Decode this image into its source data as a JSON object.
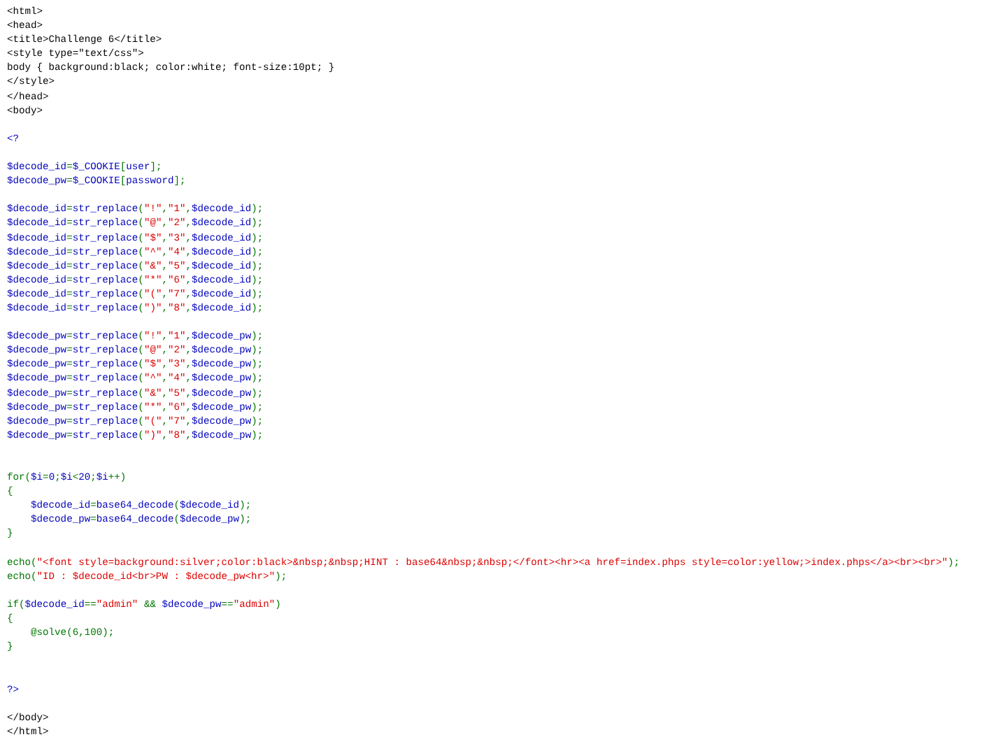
{
  "source_lines": [
    {
      "kind": "code",
      "tokens": [
        {
          "kind": "html",
          "text": "<html>"
        }
      ]
    },
    {
      "kind": "code",
      "tokens": [
        {
          "kind": "html",
          "text": "<head>"
        }
      ]
    },
    {
      "kind": "code",
      "tokens": [
        {
          "kind": "html",
          "text": "<title>Challenge 6</title>"
        }
      ]
    },
    {
      "kind": "code",
      "tokens": [
        {
          "kind": "html",
          "text": "<style type=\"text/css\">"
        }
      ]
    },
    {
      "kind": "code",
      "tokens": [
        {
          "kind": "html",
          "text": "body { background:black; color:white; font-size:10pt; }"
        }
      ]
    },
    {
      "kind": "code",
      "tokens": [
        {
          "kind": "html",
          "text": "</style>"
        }
      ]
    },
    {
      "kind": "code",
      "tokens": [
        {
          "kind": "html",
          "text": "</head>"
        }
      ]
    },
    {
      "kind": "code",
      "tokens": [
        {
          "kind": "html",
          "text": "<body>"
        }
      ]
    },
    {
      "kind": "blank"
    },
    {
      "kind": "code",
      "tokens": [
        {
          "kind": "default",
          "text": "<?"
        }
      ]
    },
    {
      "kind": "blank"
    },
    {
      "kind": "code",
      "tokens": [
        {
          "kind": "default",
          "text": "$decode_id"
        },
        {
          "kind": "keyword",
          "text": "="
        },
        {
          "kind": "default",
          "text": "$_COOKIE"
        },
        {
          "kind": "keyword",
          "text": "["
        },
        {
          "kind": "default",
          "text": "user"
        },
        {
          "kind": "keyword",
          "text": "];"
        }
      ]
    },
    {
      "kind": "code",
      "tokens": [
        {
          "kind": "default",
          "text": "$decode_pw"
        },
        {
          "kind": "keyword",
          "text": "="
        },
        {
          "kind": "default",
          "text": "$_COOKIE"
        },
        {
          "kind": "keyword",
          "text": "["
        },
        {
          "kind": "default",
          "text": "password"
        },
        {
          "kind": "keyword",
          "text": "];"
        }
      ]
    },
    {
      "kind": "blank"
    },
    {
      "kind": "code",
      "tokens": [
        {
          "kind": "default",
          "text": "$decode_id"
        },
        {
          "kind": "keyword",
          "text": "="
        },
        {
          "kind": "default",
          "text": "str_replace"
        },
        {
          "kind": "keyword",
          "text": "("
        },
        {
          "kind": "string",
          "text": "\"!\""
        },
        {
          "kind": "keyword",
          "text": ","
        },
        {
          "kind": "string",
          "text": "\"1\""
        },
        {
          "kind": "keyword",
          "text": ","
        },
        {
          "kind": "default",
          "text": "$decode_id"
        },
        {
          "kind": "keyword",
          "text": ");"
        }
      ]
    },
    {
      "kind": "code",
      "tokens": [
        {
          "kind": "default",
          "text": "$decode_id"
        },
        {
          "kind": "keyword",
          "text": "="
        },
        {
          "kind": "default",
          "text": "str_replace"
        },
        {
          "kind": "keyword",
          "text": "("
        },
        {
          "kind": "string",
          "text": "\"@\""
        },
        {
          "kind": "keyword",
          "text": ","
        },
        {
          "kind": "string",
          "text": "\"2\""
        },
        {
          "kind": "keyword",
          "text": ","
        },
        {
          "kind": "default",
          "text": "$decode_id"
        },
        {
          "kind": "keyword",
          "text": ");"
        }
      ]
    },
    {
      "kind": "code",
      "tokens": [
        {
          "kind": "default",
          "text": "$decode_id"
        },
        {
          "kind": "keyword",
          "text": "="
        },
        {
          "kind": "default",
          "text": "str_replace"
        },
        {
          "kind": "keyword",
          "text": "("
        },
        {
          "kind": "string",
          "text": "\"$\""
        },
        {
          "kind": "keyword",
          "text": ","
        },
        {
          "kind": "string",
          "text": "\"3\""
        },
        {
          "kind": "keyword",
          "text": ","
        },
        {
          "kind": "default",
          "text": "$decode_id"
        },
        {
          "kind": "keyword",
          "text": ");"
        }
      ]
    },
    {
      "kind": "code",
      "tokens": [
        {
          "kind": "default",
          "text": "$decode_id"
        },
        {
          "kind": "keyword",
          "text": "="
        },
        {
          "kind": "default",
          "text": "str_replace"
        },
        {
          "kind": "keyword",
          "text": "("
        },
        {
          "kind": "string",
          "text": "\"^\""
        },
        {
          "kind": "keyword",
          "text": ","
        },
        {
          "kind": "string",
          "text": "\"4\""
        },
        {
          "kind": "keyword",
          "text": ","
        },
        {
          "kind": "default",
          "text": "$decode_id"
        },
        {
          "kind": "keyword",
          "text": ");"
        }
      ]
    },
    {
      "kind": "code",
      "tokens": [
        {
          "kind": "default",
          "text": "$decode_id"
        },
        {
          "kind": "keyword",
          "text": "="
        },
        {
          "kind": "default",
          "text": "str_replace"
        },
        {
          "kind": "keyword",
          "text": "("
        },
        {
          "kind": "string",
          "text": "\"&\""
        },
        {
          "kind": "keyword",
          "text": ","
        },
        {
          "kind": "string",
          "text": "\"5\""
        },
        {
          "kind": "keyword",
          "text": ","
        },
        {
          "kind": "default",
          "text": "$decode_id"
        },
        {
          "kind": "keyword",
          "text": ");"
        }
      ]
    },
    {
      "kind": "code",
      "tokens": [
        {
          "kind": "default",
          "text": "$decode_id"
        },
        {
          "kind": "keyword",
          "text": "="
        },
        {
          "kind": "default",
          "text": "str_replace"
        },
        {
          "kind": "keyword",
          "text": "("
        },
        {
          "kind": "string",
          "text": "\"*\""
        },
        {
          "kind": "keyword",
          "text": ","
        },
        {
          "kind": "string",
          "text": "\"6\""
        },
        {
          "kind": "keyword",
          "text": ","
        },
        {
          "kind": "default",
          "text": "$decode_id"
        },
        {
          "kind": "keyword",
          "text": ");"
        }
      ]
    },
    {
      "kind": "code",
      "tokens": [
        {
          "kind": "default",
          "text": "$decode_id"
        },
        {
          "kind": "keyword",
          "text": "="
        },
        {
          "kind": "default",
          "text": "str_replace"
        },
        {
          "kind": "keyword",
          "text": "("
        },
        {
          "kind": "string",
          "text": "\"(\""
        },
        {
          "kind": "keyword",
          "text": ","
        },
        {
          "kind": "string",
          "text": "\"7\""
        },
        {
          "kind": "keyword",
          "text": ","
        },
        {
          "kind": "default",
          "text": "$decode_id"
        },
        {
          "kind": "keyword",
          "text": ");"
        }
      ]
    },
    {
      "kind": "code",
      "tokens": [
        {
          "kind": "default",
          "text": "$decode_id"
        },
        {
          "kind": "keyword",
          "text": "="
        },
        {
          "kind": "default",
          "text": "str_replace"
        },
        {
          "kind": "keyword",
          "text": "("
        },
        {
          "kind": "string",
          "text": "\")\""
        },
        {
          "kind": "keyword",
          "text": ","
        },
        {
          "kind": "string",
          "text": "\"8\""
        },
        {
          "kind": "keyword",
          "text": ","
        },
        {
          "kind": "default",
          "text": "$decode_id"
        },
        {
          "kind": "keyword",
          "text": ");"
        }
      ]
    },
    {
      "kind": "blank"
    },
    {
      "kind": "code",
      "tokens": [
        {
          "kind": "default",
          "text": "$decode_pw"
        },
        {
          "kind": "keyword",
          "text": "="
        },
        {
          "kind": "default",
          "text": "str_replace"
        },
        {
          "kind": "keyword",
          "text": "("
        },
        {
          "kind": "string",
          "text": "\"!\""
        },
        {
          "kind": "keyword",
          "text": ","
        },
        {
          "kind": "string",
          "text": "\"1\""
        },
        {
          "kind": "keyword",
          "text": ","
        },
        {
          "kind": "default",
          "text": "$decode_pw"
        },
        {
          "kind": "keyword",
          "text": ");"
        }
      ]
    },
    {
      "kind": "code",
      "tokens": [
        {
          "kind": "default",
          "text": "$decode_pw"
        },
        {
          "kind": "keyword",
          "text": "="
        },
        {
          "kind": "default",
          "text": "str_replace"
        },
        {
          "kind": "keyword",
          "text": "("
        },
        {
          "kind": "string",
          "text": "\"@\""
        },
        {
          "kind": "keyword",
          "text": ","
        },
        {
          "kind": "string",
          "text": "\"2\""
        },
        {
          "kind": "keyword",
          "text": ","
        },
        {
          "kind": "default",
          "text": "$decode_pw"
        },
        {
          "kind": "keyword",
          "text": ");"
        }
      ]
    },
    {
      "kind": "code",
      "tokens": [
        {
          "kind": "default",
          "text": "$decode_pw"
        },
        {
          "kind": "keyword",
          "text": "="
        },
        {
          "kind": "default",
          "text": "str_replace"
        },
        {
          "kind": "keyword",
          "text": "("
        },
        {
          "kind": "string",
          "text": "\"$\""
        },
        {
          "kind": "keyword",
          "text": ","
        },
        {
          "kind": "string",
          "text": "\"3\""
        },
        {
          "kind": "keyword",
          "text": ","
        },
        {
          "kind": "default",
          "text": "$decode_pw"
        },
        {
          "kind": "keyword",
          "text": ");"
        }
      ]
    },
    {
      "kind": "code",
      "tokens": [
        {
          "kind": "default",
          "text": "$decode_pw"
        },
        {
          "kind": "keyword",
          "text": "="
        },
        {
          "kind": "default",
          "text": "str_replace"
        },
        {
          "kind": "keyword",
          "text": "("
        },
        {
          "kind": "string",
          "text": "\"^\""
        },
        {
          "kind": "keyword",
          "text": ","
        },
        {
          "kind": "string",
          "text": "\"4\""
        },
        {
          "kind": "keyword",
          "text": ","
        },
        {
          "kind": "default",
          "text": "$decode_pw"
        },
        {
          "kind": "keyword",
          "text": ");"
        }
      ]
    },
    {
      "kind": "code",
      "tokens": [
        {
          "kind": "default",
          "text": "$decode_pw"
        },
        {
          "kind": "keyword",
          "text": "="
        },
        {
          "kind": "default",
          "text": "str_replace"
        },
        {
          "kind": "keyword",
          "text": "("
        },
        {
          "kind": "string",
          "text": "\"&\""
        },
        {
          "kind": "keyword",
          "text": ","
        },
        {
          "kind": "string",
          "text": "\"5\""
        },
        {
          "kind": "keyword",
          "text": ","
        },
        {
          "kind": "default",
          "text": "$decode_pw"
        },
        {
          "kind": "keyword",
          "text": ");"
        }
      ]
    },
    {
      "kind": "code",
      "tokens": [
        {
          "kind": "default",
          "text": "$decode_pw"
        },
        {
          "kind": "keyword",
          "text": "="
        },
        {
          "kind": "default",
          "text": "str_replace"
        },
        {
          "kind": "keyword",
          "text": "("
        },
        {
          "kind": "string",
          "text": "\"*\""
        },
        {
          "kind": "keyword",
          "text": ","
        },
        {
          "kind": "string",
          "text": "\"6\""
        },
        {
          "kind": "keyword",
          "text": ","
        },
        {
          "kind": "default",
          "text": "$decode_pw"
        },
        {
          "kind": "keyword",
          "text": ");"
        }
      ]
    },
    {
      "kind": "code",
      "tokens": [
        {
          "kind": "default",
          "text": "$decode_pw"
        },
        {
          "kind": "keyword",
          "text": "="
        },
        {
          "kind": "default",
          "text": "str_replace"
        },
        {
          "kind": "keyword",
          "text": "("
        },
        {
          "kind": "string",
          "text": "\"(\""
        },
        {
          "kind": "keyword",
          "text": ","
        },
        {
          "kind": "string",
          "text": "\"7\""
        },
        {
          "kind": "keyword",
          "text": ","
        },
        {
          "kind": "default",
          "text": "$decode_pw"
        },
        {
          "kind": "keyword",
          "text": ");"
        }
      ]
    },
    {
      "kind": "code",
      "tokens": [
        {
          "kind": "default",
          "text": "$decode_pw"
        },
        {
          "kind": "keyword",
          "text": "="
        },
        {
          "kind": "default",
          "text": "str_replace"
        },
        {
          "kind": "keyword",
          "text": "("
        },
        {
          "kind": "string",
          "text": "\")\""
        },
        {
          "kind": "keyword",
          "text": ","
        },
        {
          "kind": "string",
          "text": "\"8\""
        },
        {
          "kind": "keyword",
          "text": ","
        },
        {
          "kind": "default",
          "text": "$decode_pw"
        },
        {
          "kind": "keyword",
          "text": ");"
        }
      ]
    },
    {
      "kind": "blank"
    },
    {
      "kind": "blank"
    },
    {
      "kind": "code",
      "tokens": [
        {
          "kind": "keyword",
          "text": "for("
        },
        {
          "kind": "default",
          "text": "$i"
        },
        {
          "kind": "keyword",
          "text": "="
        },
        {
          "kind": "default",
          "text": "0"
        },
        {
          "kind": "keyword",
          "text": ";"
        },
        {
          "kind": "default",
          "text": "$i"
        },
        {
          "kind": "keyword",
          "text": "<"
        },
        {
          "kind": "default",
          "text": "20"
        },
        {
          "kind": "keyword",
          "text": ";"
        },
        {
          "kind": "default",
          "text": "$i"
        },
        {
          "kind": "keyword",
          "text": "++)"
        }
      ]
    },
    {
      "kind": "code",
      "tokens": [
        {
          "kind": "keyword",
          "text": "{"
        }
      ]
    },
    {
      "kind": "code",
      "tokens": [
        {
          "kind": "default",
          "text": "    $decode_id"
        },
        {
          "kind": "keyword",
          "text": "="
        },
        {
          "kind": "default",
          "text": "base64_decode"
        },
        {
          "kind": "keyword",
          "text": "("
        },
        {
          "kind": "default",
          "text": "$decode_id"
        },
        {
          "kind": "keyword",
          "text": ");"
        }
      ]
    },
    {
      "kind": "code",
      "tokens": [
        {
          "kind": "default",
          "text": "    $decode_pw"
        },
        {
          "kind": "keyword",
          "text": "="
        },
        {
          "kind": "default",
          "text": "base64_decode"
        },
        {
          "kind": "keyword",
          "text": "("
        },
        {
          "kind": "default",
          "text": "$decode_pw"
        },
        {
          "kind": "keyword",
          "text": ");"
        }
      ]
    },
    {
      "kind": "code",
      "tokens": [
        {
          "kind": "keyword",
          "text": "}"
        }
      ]
    },
    {
      "kind": "blank"
    },
    {
      "kind": "code",
      "tokens": [
        {
          "kind": "keyword",
          "text": "echo("
        },
        {
          "kind": "string",
          "text": "\"<font style=background:silver;color:black>&nbsp;&nbsp;HINT : base64&nbsp;&nbsp;</font><hr><a href=index.phps style=color:yellow;>index.phps</a><br><br>\""
        },
        {
          "kind": "keyword",
          "text": ");"
        }
      ]
    },
    {
      "kind": "code",
      "tokens": [
        {
          "kind": "keyword",
          "text": "echo("
        },
        {
          "kind": "string",
          "text": "\"ID : $decode_id<br>PW : $decode_pw<hr>\""
        },
        {
          "kind": "keyword",
          "text": ");"
        }
      ]
    },
    {
      "kind": "blank"
    },
    {
      "kind": "code",
      "tokens": [
        {
          "kind": "keyword",
          "text": "if("
        },
        {
          "kind": "default",
          "text": "$decode_id"
        },
        {
          "kind": "keyword",
          "text": "=="
        },
        {
          "kind": "string",
          "text": "\"admin\""
        },
        {
          "kind": "keyword",
          "text": " && "
        },
        {
          "kind": "default",
          "text": "$decode_pw"
        },
        {
          "kind": "keyword",
          "text": "=="
        },
        {
          "kind": "string",
          "text": "\"admin\""
        },
        {
          "kind": "keyword",
          "text": ")"
        }
      ]
    },
    {
      "kind": "code",
      "tokens": [
        {
          "kind": "keyword",
          "text": "{"
        }
      ]
    },
    {
      "kind": "code",
      "tokens": [
        {
          "kind": "keyword",
          "text": "    @solve(6,100);"
        }
      ]
    },
    {
      "kind": "code",
      "tokens": [
        {
          "kind": "keyword",
          "text": "}"
        }
      ]
    },
    {
      "kind": "blank"
    },
    {
      "kind": "blank"
    },
    {
      "kind": "code",
      "tokens": [
        {
          "kind": "default",
          "text": "?>"
        }
      ]
    },
    {
      "kind": "blank"
    },
    {
      "kind": "code",
      "tokens": [
        {
          "kind": "html",
          "text": "</body>"
        }
      ]
    },
    {
      "kind": "code",
      "tokens": [
        {
          "kind": "html",
          "text": "</html>"
        }
      ]
    }
  ]
}
